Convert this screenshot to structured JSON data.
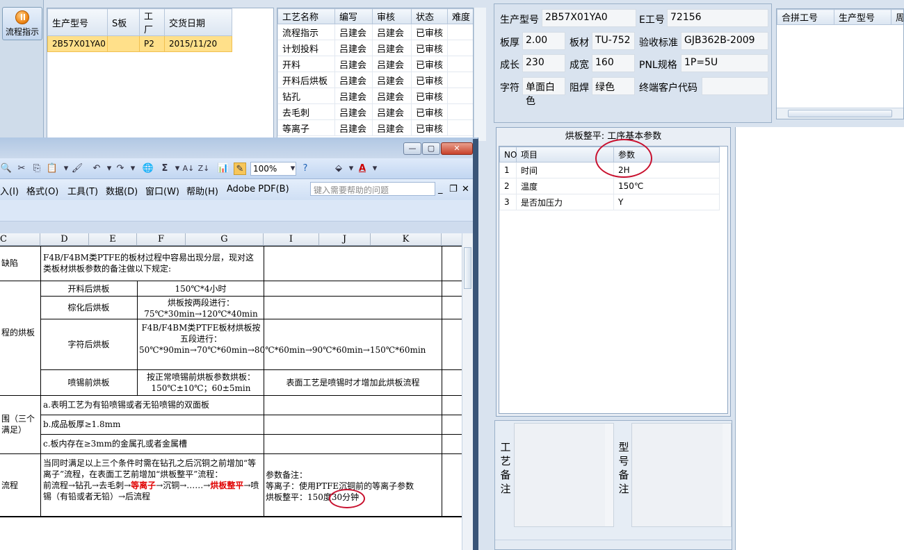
{
  "left_nav": {
    "flow_label": "流程指示"
  },
  "orders": {
    "headers": [
      "生产型号",
      "S板",
      "工厂",
      "交货日期"
    ],
    "rows": [
      [
        "2B57X01YA0",
        "",
        "P2",
        "2015/11/20"
      ]
    ]
  },
  "process": {
    "headers": [
      "工艺名称",
      "编写",
      "审核",
      "状态",
      "难度"
    ],
    "rows": [
      [
        "流程指示",
        "吕建会",
        "吕建会",
        "已审核",
        ""
      ],
      [
        "计划投料",
        "吕建会",
        "吕建会",
        "已审核",
        ""
      ],
      [
        "开料",
        "吕建会",
        "吕建会",
        "已审核",
        ""
      ],
      [
        "开料后烘板",
        "吕建会",
        "吕建会",
        "已审核",
        ""
      ],
      [
        "钻孔",
        "吕建会",
        "吕建会",
        "已审核",
        ""
      ],
      [
        "去毛刺",
        "吕建会",
        "吕建会",
        "已审核",
        ""
      ],
      [
        "等离子",
        "吕建会",
        "吕建会",
        "已审核",
        ""
      ]
    ]
  },
  "info": {
    "model_label": "生产型号",
    "model_value": "2B57X01YA0",
    "eno_label": "E工号",
    "eno_value": "72156",
    "thick_label": "板厚",
    "thick_value": "2.00",
    "material_label": "板材",
    "material_value": "TU-752",
    "std_label": "验收标准",
    "std_value": "GJB362B-2009",
    "len_label": "成长",
    "len_value": "230",
    "wid_label": "成宽",
    "wid_value": "160",
    "pnl_label": "PNL规格",
    "pnl_value": "1P=5U",
    "char_label": "字符",
    "char_value": "单面白色",
    "mask_label": "阻焊",
    "mask_value": "绿色",
    "cust_label": "终端客户代码",
    "cust_value": ""
  },
  "merge": {
    "headers": [
      "合拼工号",
      "生产型号",
      "周期"
    ]
  },
  "params": {
    "title": "烘板整平: 工序基本参数",
    "headers": [
      "NO",
      "项目",
      "参数"
    ],
    "rows": [
      [
        "1",
        "时间",
        "2H"
      ],
      [
        "2",
        "温度",
        "150℃"
      ],
      [
        "3",
        "是否加压力",
        "Y"
      ]
    ]
  },
  "remarks": {
    "process_label": [
      "工",
      "艺",
      "备",
      "注"
    ],
    "model_label": [
      "型",
      "号",
      "备",
      "注"
    ]
  },
  "excel": {
    "zoom": "100%",
    "help_placeholder": "键入需要帮助的问题",
    "menu": [
      "入(I)",
      "格式(O)",
      "工具(T)",
      "数据(D)",
      "窗口(W)",
      "帮助(H)",
      "Adobe PDF(B)"
    ],
    "columns": [
      "C",
      "D",
      "E",
      "F",
      "G",
      "I",
      "J",
      "K"
    ],
    "cells": {
      "r1_label": "缺陷",
      "r1_text": "F4B/F4BM类PTFE的板材过程中容易出现分层，现对这类板材烘板参数的备注做以下规定:",
      "r2_label": "程的烘板",
      "bake1_name": "开料后烘板",
      "bake1_value": "150℃*4小时",
      "bake2_name": "棕化后烘板",
      "bake2_value": "烘板按两段进行：75℃*30min→120℃*40min",
      "bake3_name": "字符后烘板",
      "bake3_value": "F4B/F4BM类PTFE板材烘板按五段进行：50℃*90min→70℃*60min→80℃*60min→90℃*60min→150℃*60min",
      "bake4_name": "喷锡前烘板",
      "bake4_value": "按正常喷锡前烘板参数烘板：150℃±10℃；60±5min",
      "bake4_note": "表面工艺是喷锡时才增加此烘板流程",
      "r3_label": "围（三个满足）",
      "cond_a": "a.表明工艺为有铅喷锡或者无铅喷锡的双面板",
      "cond_b": "b.成品板厚≥1.8mm",
      "cond_c": "c.板内存在≥3mm的金属孔或者金属槽",
      "r4_label": "流程",
      "flow_p1": "当同时满足以上三个条件时需在钻孔之后沉铜之前增加“等离子”流程，在表面工艺前增加“烘板整平”流程：",
      "flow_p2a": "前流程→钻孔→去毛刺→",
      "flow_p2b": "等离子",
      "flow_p2c": "→沉铜→……→",
      "flow_p2d": "烘板整平",
      "flow_p2e": "→喷锡（有铅或者无铅）→后流程",
      "note1": "参数备注：",
      "note2": "等离子：使用PTFE沉铜前的等离子参数",
      "note3": "烘板整平：150度30分钟"
    }
  },
  "colors": {
    "annotation": "#c8102e",
    "selected_row": "#ffe08a",
    "red_text": "#e00000"
  }
}
